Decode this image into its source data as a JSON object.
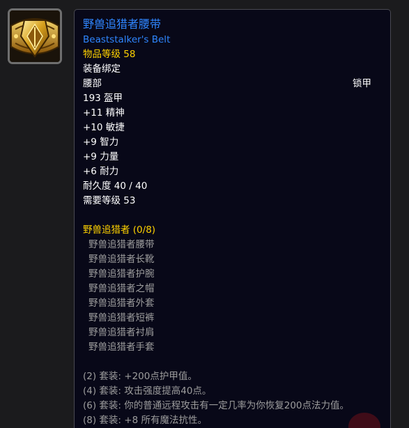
{
  "item": {
    "name": "野兽追猎者腰带",
    "english_name": "Beaststalker's Belt",
    "item_level": "物品等级 58",
    "binding": "装备绑定",
    "slot": "腰部",
    "armor_type": "锁甲",
    "armor": "193 盔甲",
    "stats": [
      "+11 精神",
      "+10 敏捷",
      "+9 智力",
      "+9 力量",
      "+6 耐力"
    ],
    "durability": "耐久度 40 / 40",
    "required_level": "需要等级 53",
    "icon": "golden-belt-icon"
  },
  "set": {
    "title": "野兽追猎者 (0/8)",
    "pieces": [
      "野兽追猎者腰带",
      "野兽追猎者长靴",
      "野兽追猎者护腕",
      "野兽追猎者之帽",
      "野兽追猎者外套",
      "野兽追猎者短裤",
      "野兽追猎者衬肩",
      "野兽追猎者手套"
    ],
    "bonuses": [
      "(2) 套装: +200点护甲值。",
      "(4) 套装: 攻击强度提高40点。",
      "(6) 套装: 你的普通远程攻击有一定几率为你恢复200点法力值。",
      "(8) 套装: +8 所有魔法抗性。"
    ]
  },
  "colors": {
    "background": "#1b1b1d",
    "tooltip_bg": "#080818",
    "item_name": "#2f86ff",
    "highlight": "#ffd200",
    "inactive": "#9d9d9d",
    "text": "#ffffff"
  }
}
